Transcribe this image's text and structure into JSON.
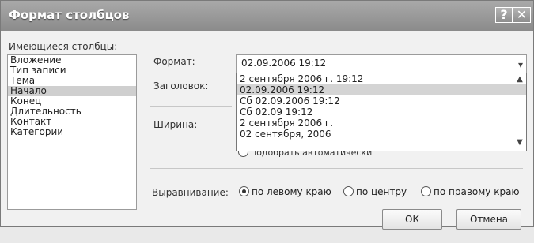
{
  "window": {
    "title": "Формат столбцов",
    "help_glyph": "?",
    "close_glyph": "✕"
  },
  "available": {
    "label": "Имеющиеся столбцы:",
    "items": [
      "Вложение",
      "Тип записи",
      "Тема",
      "Начало",
      "Конец",
      "Длительность",
      "Контакт",
      "Категории"
    ],
    "selected_index": 3
  },
  "format": {
    "label": "Формат:",
    "value": "02.09.2006 19:12",
    "options": [
      "2 сентября 2006 г. 19:12",
      "02.09.2006 19:12",
      "Сб 02.09.2006 19:12",
      "Сб 02.09 19:12",
      "2 сентября 2006 г.",
      "02 сентября, 2006"
    ],
    "selected_index": 1
  },
  "header": {
    "label": "Заголовок:"
  },
  "width": {
    "label": "Ширина:",
    "autofit_fragment": "подобрать автоматически"
  },
  "alignment": {
    "label": "Выравнивание:",
    "options": [
      "по левому краю",
      "по центру",
      "по правому краю"
    ],
    "selected_index": 0
  },
  "buttons": {
    "ok": "ОК",
    "cancel": "Отмена"
  }
}
